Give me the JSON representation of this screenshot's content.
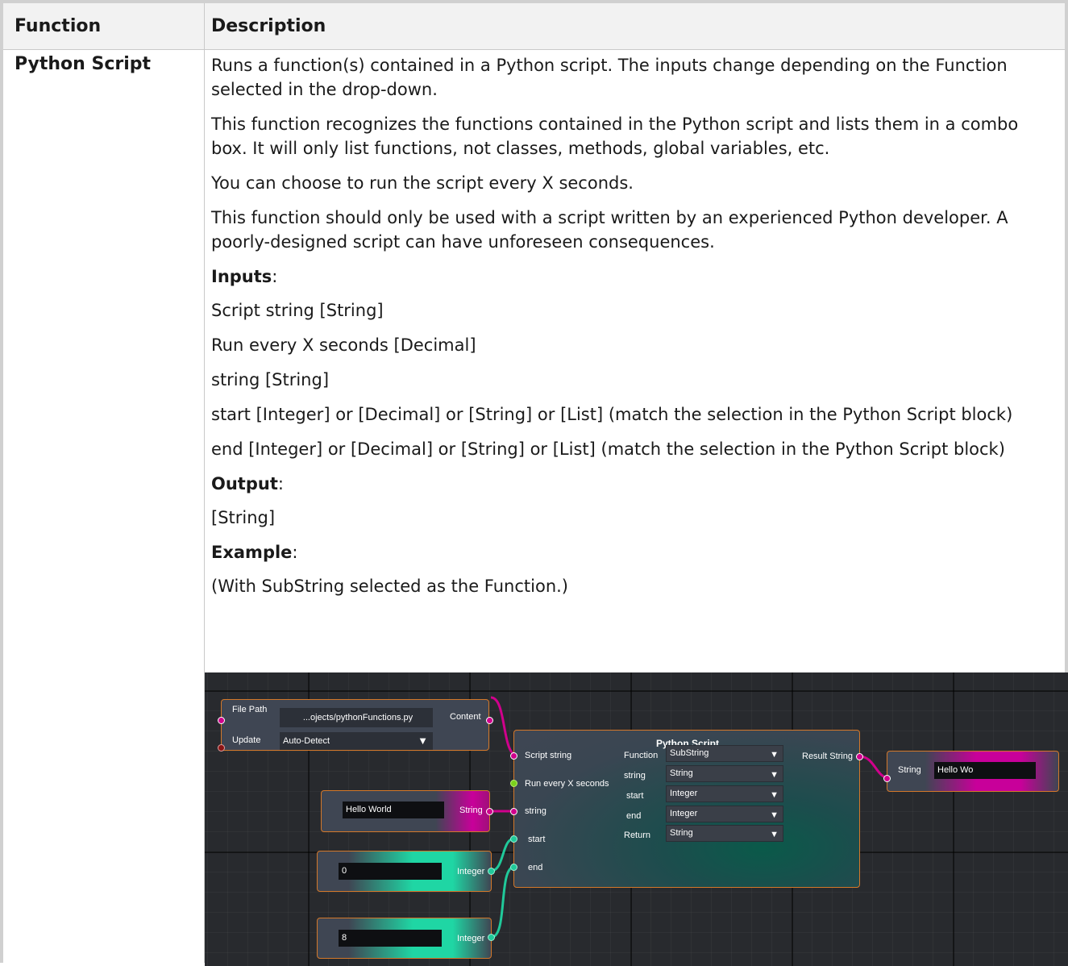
{
  "table": {
    "header": {
      "function": "Function",
      "description": "Description"
    },
    "function_name": "Python Script",
    "paragraphs": [
      "Runs a function(s) contained in a Python script. The inputs change depending on the Function selected in the drop-down.",
      "This function recognizes the functions contained in the Python script and lists them in a combo box. It will only list functions, not classes, methods, global variables, etc.",
      "You can choose to run the script every X seconds.",
      "This function should only be used with a script written by an experienced Python developer. A poorly-designed script can have unforeseen consequences."
    ],
    "inputs_heading": "Inputs",
    "inputs": [
      "Script string [String]",
      "Run every X seconds [Decimal]",
      "string [String]",
      "start [Integer] or [Decimal] or [String] or [List] (match the selection in the Python Script block)",
      "end [Integer] or [Decimal] or [String] or [List] (match the selection in the Python Script block)"
    ],
    "output_heading": "Output",
    "output": "[String]",
    "example_heading": "Example",
    "example_note": "(With SubString selected as the Function.)",
    "colon": ":"
  },
  "graph": {
    "file_node": {
      "file_path_label": "File Path",
      "file_path_value": "...ojects/pythonFunctions.py",
      "content_label": "Content",
      "update_label": "Update",
      "update_value": "Auto-Detect"
    },
    "string_node": {
      "value": "Hello World",
      "label": "String"
    },
    "int_node_1": {
      "value": "0",
      "label": "Integer"
    },
    "int_node_2": {
      "value": "8",
      "label": "Integer"
    },
    "python_node": {
      "title": "Python Script",
      "inputs": [
        "Script string",
        "Run every X seconds",
        "string",
        "start",
        "end"
      ],
      "params": [
        {
          "label": "Function",
          "value": "SubString"
        },
        {
          "label": "string",
          "value": "String"
        },
        {
          "label": "start",
          "value": "Integer"
        },
        {
          "label": "end",
          "value": "Integer"
        },
        {
          "label": "Return",
          "value": "String"
        }
      ],
      "output_label": "Result String"
    },
    "result_node": {
      "label": "String",
      "value": "Hello Wo"
    },
    "colors": {
      "pink": "#d0008c",
      "teal": "#20c99a",
      "border": "#d4782a",
      "node": "#3f4653"
    }
  }
}
